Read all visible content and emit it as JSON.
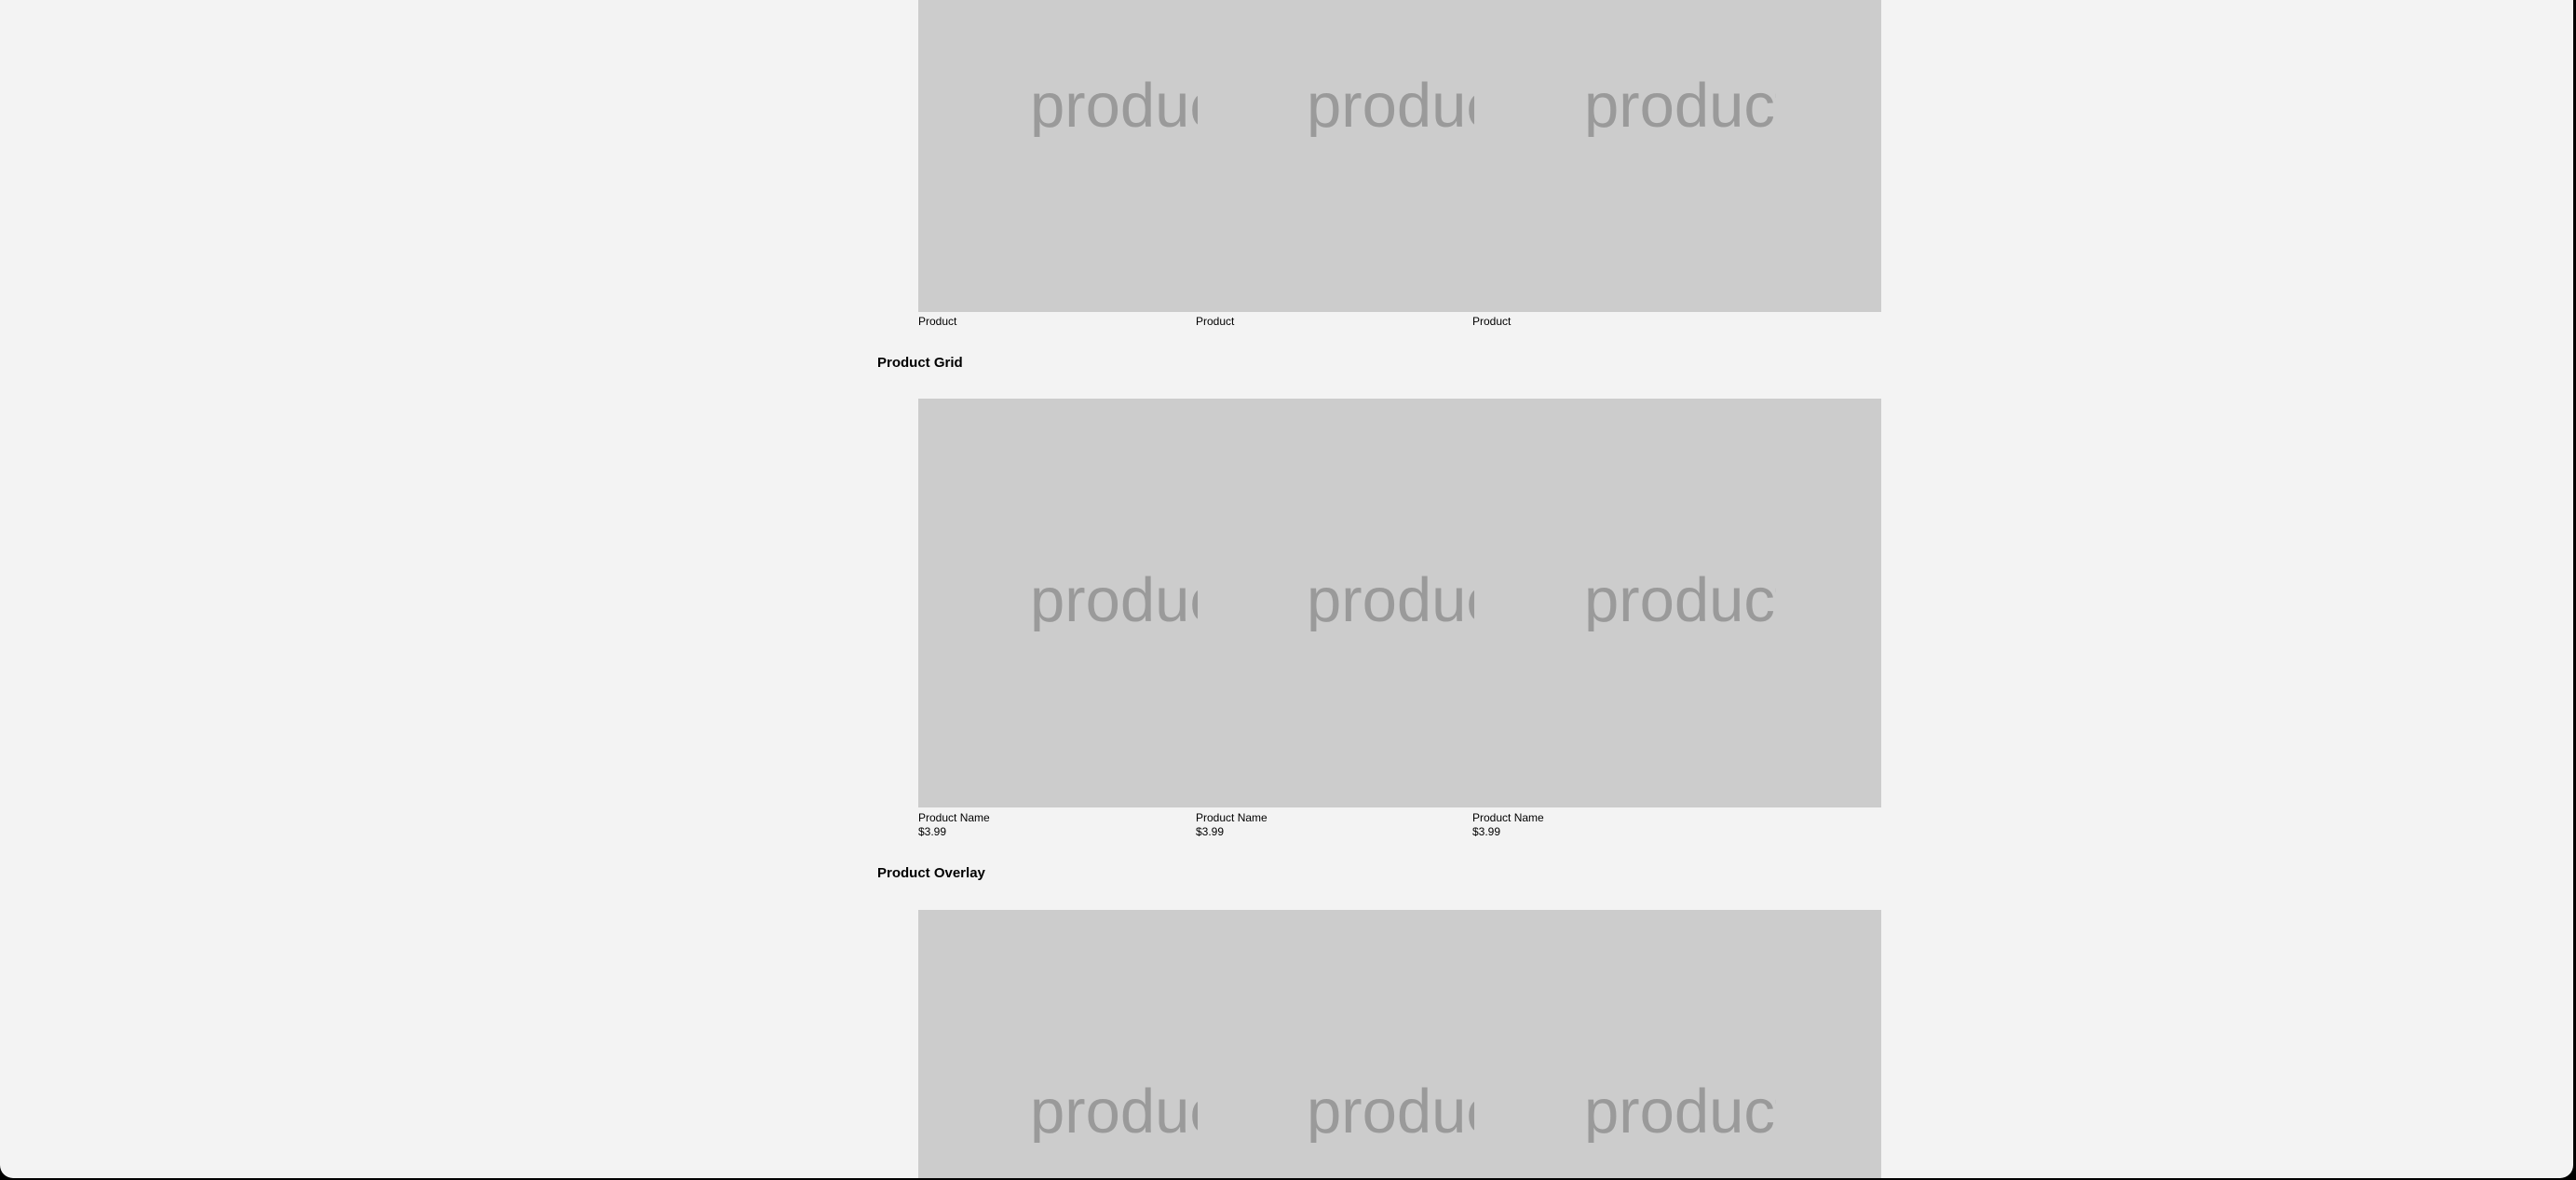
{
  "carousel": {
    "placeholder_text": "product",
    "items": [
      {
        "label": "Product"
      },
      {
        "label": "Product"
      },
      {
        "label": "Product"
      }
    ]
  },
  "product_grid": {
    "heading": "Product Grid",
    "placeholder_text": "product",
    "items": [
      {
        "name": "Product Name",
        "price": "$3.99"
      },
      {
        "name": "Product Name",
        "price": "$3.99"
      },
      {
        "name": "Product Name",
        "price": "$3.99"
      }
    ]
  },
  "product_overlay": {
    "heading": "Product Overlay",
    "placeholder_text": "product"
  }
}
